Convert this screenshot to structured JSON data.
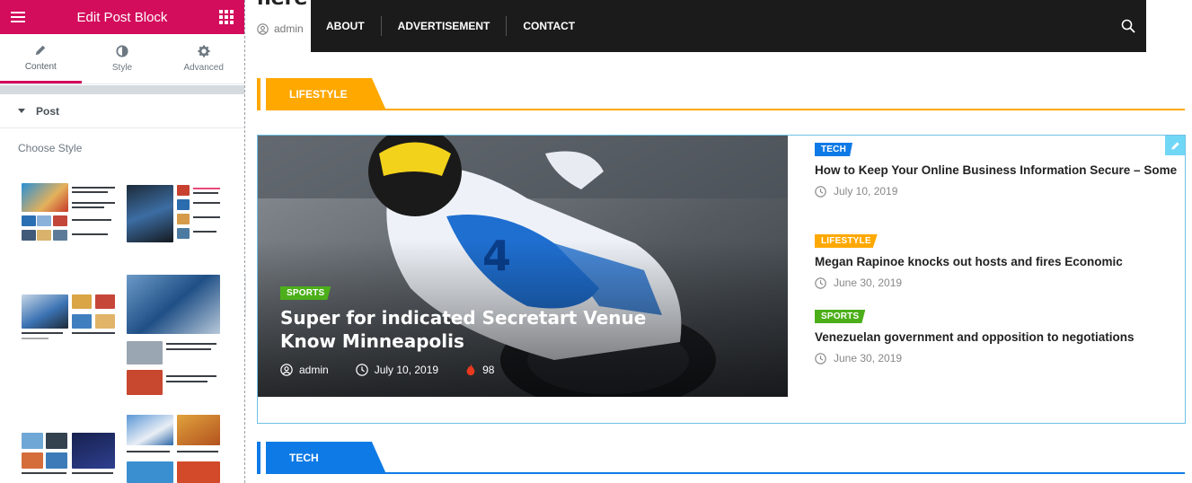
{
  "panel": {
    "title": "Edit Post Block",
    "tabs": [
      {
        "label": "Content",
        "icon": "pencil-icon",
        "active": true
      },
      {
        "label": "Style",
        "icon": "contrast-icon",
        "active": false
      },
      {
        "label": "Advanced",
        "icon": "gear-icon",
        "active": false
      }
    ],
    "section": "Post",
    "choose_style_label": "Choose Style",
    "accent": "#d30c5c"
  },
  "site": {
    "partial_title": "here s",
    "partial_author": "admin",
    "nav": [
      "ABOUT",
      "ADVERTISEMENT",
      "CONTACT"
    ],
    "sections": [
      {
        "label": "LIFESTYLE",
        "color": "#ffa800"
      },
      {
        "label": "TECH",
        "color": "#0e7ae6"
      }
    ],
    "hero": {
      "category": "SPORTS",
      "category_color": "#4caf1a",
      "title": "Super for indicated Secretart Venue Know Minneapolis",
      "author": "admin",
      "date": "July 10, 2019",
      "views": "98"
    },
    "side_posts": [
      {
        "category": "TECH",
        "category_color": "#0e7ae6",
        "title": "How to Keep Your Online Business Information Secure – Some",
        "date": "July 10, 2019"
      },
      {
        "category": "LIFESTYLE",
        "category_color": "#ffa800",
        "title": "Megan Rapinoe knocks out hosts and fires Economic",
        "date": "June 30, 2019"
      },
      {
        "category": "SPORTS",
        "category_color": "#4caf1a",
        "title": "Venezuelan government and opposition to negotiations",
        "date": "June 30, 2019"
      }
    ]
  }
}
